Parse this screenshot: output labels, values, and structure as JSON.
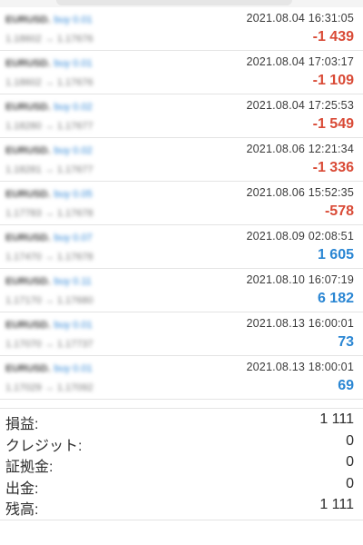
{
  "trades": [
    {
      "symbol": "EURUSD.",
      "side": "buy 0.01",
      "prices": "1.18602 → 1.17676",
      "time": "2021.08.04 16:31:05",
      "profit": "-1 439",
      "sign": "neg"
    },
    {
      "symbol": "EURUSD.",
      "side": "buy 0.01",
      "prices": "1.18602 → 1.17676",
      "time": "2021.08.04 17:03:17",
      "profit": "-1 109",
      "sign": "neg"
    },
    {
      "symbol": "EURUSD.",
      "side": "buy 0.02",
      "prices": "1.18280 → 1.17677",
      "time": "2021.08.04 17:25:53",
      "profit": "-1 549",
      "sign": "neg"
    },
    {
      "symbol": "EURUSD.",
      "side": "buy 0.02",
      "prices": "1.18281 → 1.17677",
      "time": "2021.08.06 12:21:34",
      "profit": "-1 336",
      "sign": "neg"
    },
    {
      "symbol": "EURUSD.",
      "side": "buy 0.05",
      "prices": "1.17783 → 1.17678",
      "time": "2021.08.06 15:52:35",
      "profit": "-578",
      "sign": "neg"
    },
    {
      "symbol": "EURUSD.",
      "side": "buy 0.07",
      "prices": "1.17470 → 1.17678",
      "time": "2021.08.09 02:08:51",
      "profit": "1 605",
      "sign": "pos"
    },
    {
      "symbol": "EURUSD.",
      "side": "buy 0.11",
      "prices": "1.17170 → 1.17680",
      "time": "2021.08.10 16:07:19",
      "profit": "6 182",
      "sign": "pos"
    },
    {
      "symbol": "EURUSD.",
      "side": "buy 0.01",
      "prices": "1.17070 → 1.17737",
      "time": "2021.08.13 16:00:01",
      "profit": "73",
      "sign": "pos"
    },
    {
      "symbol": "EURUSD.",
      "side": "buy 0.01",
      "prices": "1.17029 → 1.17092",
      "time": "2021.08.13 18:00:01",
      "profit": "69",
      "sign": "pos"
    }
  ],
  "summary": {
    "profit_label": "損益:",
    "profit_value": "1 111",
    "credit_label": "クレジット:",
    "credit_value": "0",
    "deposit_label": "証拠金:",
    "deposit_value": "0",
    "withdrawal_label": "出金:",
    "withdrawal_value": "0",
    "balance_label": "残高:",
    "balance_value": "1 111"
  },
  "colors": {
    "negative": "#d94a36",
    "positive": "#2a86d3",
    "buy_side": "#2f86d6"
  }
}
